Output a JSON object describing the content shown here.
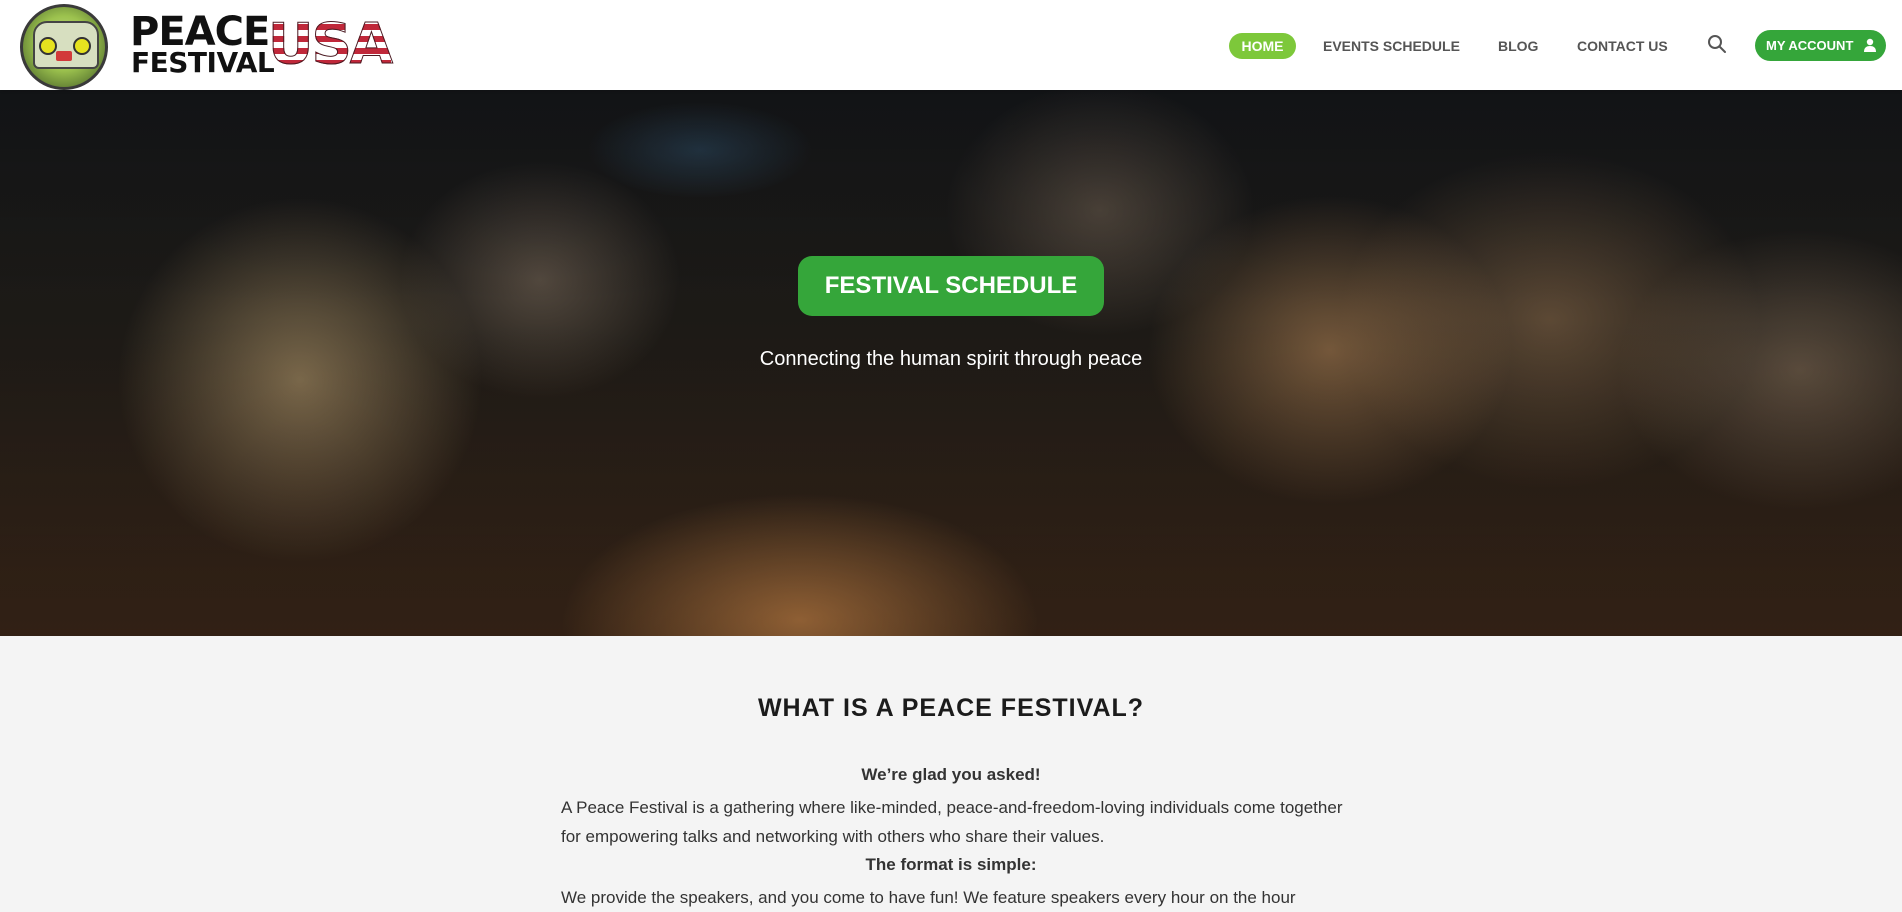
{
  "brand": {
    "name_line1": "PEACE",
    "name_line2": "FESTIVAL",
    "name_accent": "USA",
    "logo_icon": "hippie-bus-badge"
  },
  "nav": {
    "items": [
      {
        "label": "HOME",
        "active": true
      },
      {
        "label": "EVENTS SCHEDULE",
        "active": false
      },
      {
        "label": "BLOG",
        "active": false
      },
      {
        "label": "CONTACT US",
        "active": false
      }
    ],
    "search_icon": "search-icon",
    "account_label": "MY ACCOUNT",
    "account_icon": "user-icon"
  },
  "hero": {
    "button_label": "FESTIVAL SCHEDULE",
    "tagline": "Connecting the human spirit through peace"
  },
  "about": {
    "title": "WHAT IS A PEACE FESTIVAL?",
    "subtitle1": "We’re glad you asked!",
    "paragraph1": "A Peace Festival is a gathering where like-minded, peace-and-freedom-loving individuals come together for empowering talks and networking with others who share their values.",
    "subtitle2": "The format is simple:",
    "paragraph2": "We provide the speakers, and you come to have fun! We feature speakers every hour on the hour"
  },
  "colors": {
    "accent_green": "#35a63a",
    "active_nav": "#7dc83a",
    "nav_text": "#555555",
    "section_bg": "#f4f4f4"
  }
}
